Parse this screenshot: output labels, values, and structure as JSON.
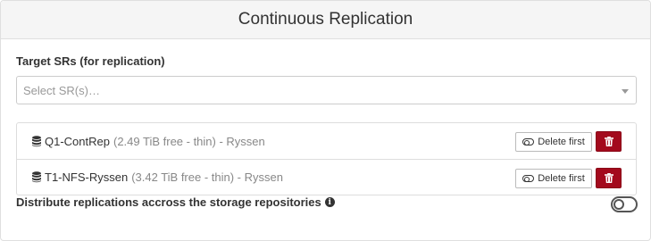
{
  "panel": {
    "title": "Continuous Replication"
  },
  "target_srs": {
    "label": "Target SRs (for replication)",
    "placeholder": "Select SR(s)…"
  },
  "sr_items": [
    {
      "name": "Q1-ContRep",
      "meta": "(2.49 TiB free - thin) - Ryssen",
      "delete_first_label": "Delete first"
    },
    {
      "name": "T1-NFS-Ryssen",
      "meta": "(3.42 TiB free - thin) - Ryssen",
      "delete_first_label": "Delete first"
    }
  ],
  "distribute": {
    "label": "Distribute replications accross the storage repositories",
    "info_icon": "info-circle-icon",
    "enabled": false
  },
  "colors": {
    "danger": "#a30a1d",
    "header_bg": "#f5f5f5"
  }
}
